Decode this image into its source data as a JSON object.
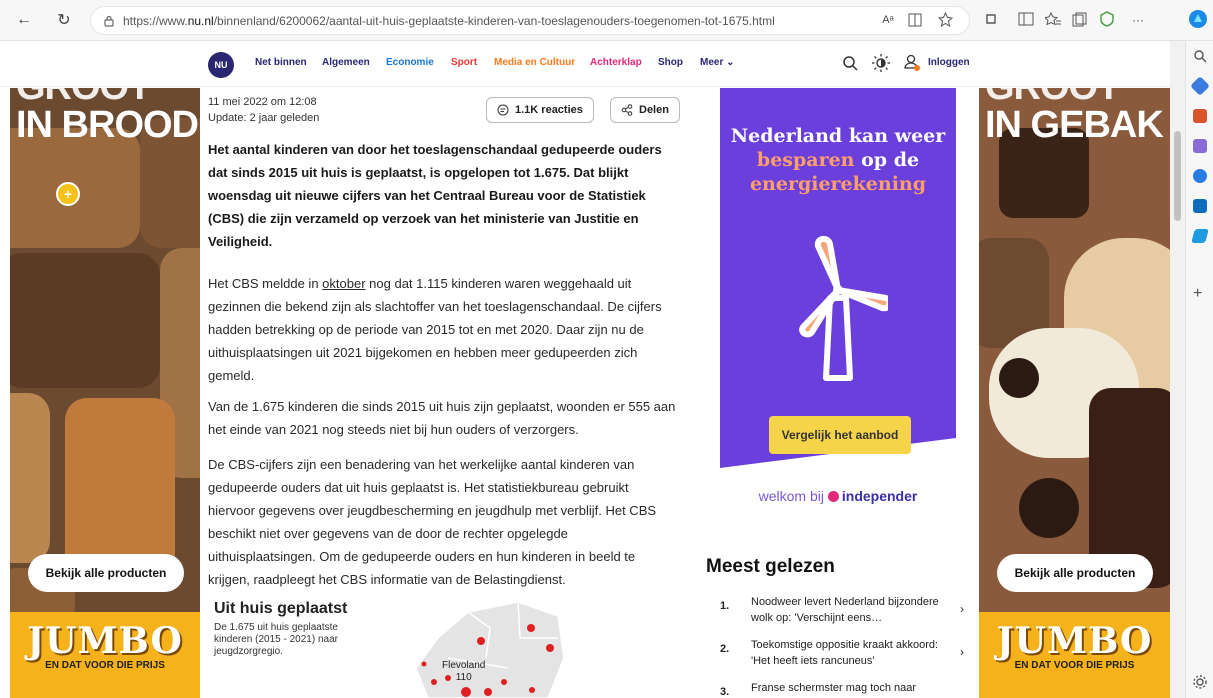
{
  "browser": {
    "url_prefix": "https://www.",
    "url_domain": "nu.nl",
    "url_path": "/binnenland/6200062/aantal-uit-huis-geplaatste-kinderen-van-toeslagenouders-toegenomen-tot-1675.html",
    "nav_back": "←",
    "nav_refresh": "↻",
    "read_aloud": "Aᵃ",
    "more": "···"
  },
  "site_nav": {
    "logo": "NU",
    "items": [
      {
        "label": "Net binnen",
        "color": "#2b2672"
      },
      {
        "label": "Algemeen",
        "color": "#2b2672"
      },
      {
        "label": "Economie",
        "color": "#1976d2"
      },
      {
        "label": "Sport",
        "color": "#e53935"
      },
      {
        "label": "Media en Cultuur",
        "color": "#ff7a1a"
      },
      {
        "label": "Achterklap",
        "color": "#e0287d"
      },
      {
        "label": "Shop",
        "color": "#2b2672"
      },
      {
        "label": "Meer ⌄",
        "color": "#2b2672"
      }
    ],
    "login": "Inloggen"
  },
  "ad_left": {
    "headline_1": "GROOT",
    "headline_2": "IN BROOD",
    "button": "Bekijk alle producten",
    "brand": "JUMBO",
    "tagline": "EN DAT VOOR DIE PRIJS"
  },
  "ad_right": {
    "headline_1": "GROOT",
    "headline_2": "IN GEBAK",
    "button": "Bekijk alle producten",
    "brand": "JUMBO",
    "tagline": "EN DAT VOOR DIE PRIJS"
  },
  "article": {
    "date": "11 mei 2022 om 12:08",
    "update": "Update: 2 jaar geleden",
    "reactions": "1.1K reacties",
    "share": "Delen",
    "lead": "Het aantal kinderen van door het toeslagenschandaal gedupeerde ouders dat sinds 2015 uit huis is geplaatst, is opgelopen tot 1.675. Dat blijkt woensdag uit nieuwe cijfers van het Centraal Bureau voor de Statistiek (CBS) die zijn verzameld op verzoek van het ministerie van Justitie en Veiligheid.",
    "p1_a": "Het CBS meldde in ",
    "p1_link": "oktober",
    "p1_b": " nog dat 1.115 kinderen waren weggehaald uit gezinnen die bekend zijn als slachtoffer van het toeslagenschandaal. De cijfers hadden betrekking op de periode van 2015 tot en met 2020. Daar zijn nu de uithuisplaatsingen uit 2021 bijgekomen en hebben meer gedupeerden zich gemeld.",
    "p2": "Van de 1.675 kinderen die sinds 2015 uit huis zijn geplaatst, woonden er 555 aan het einde van 2021 nog steeds niet bij hun ouders of verzorgers.",
    "p3": "De CBS-cijfers zijn een benadering van het werkelijke aantal kinderen van gedupeerde ouders dat uit huis geplaatst is. Het statistiekbureau gebruikt hiervoor gegevens over jeugdbescherming en jeugdhulp met verblijf. Het CBS beschikt niet over gegevens van de door de rechter opgelegde uithuisplaatsingen. Om de gedupeerde ouders en hun kinderen in beeld te krijgen, raadpleegt het CBS informatie van de Belastingdienst."
  },
  "map": {
    "title": "Uit huis geplaatst",
    "description": "De 1.675 uit huis geplaatste kinderen (2015 - 2021) naar jeugdzorgregio.",
    "region_label": "Flevoland",
    "region_value": "110"
  },
  "ad_mid": {
    "line1": "Nederland kan weer",
    "line2_orange": "besparen",
    "line2_white": " op de",
    "line3": "energierekening",
    "cta": "Vergelijk het aanbod",
    "welkom": "welkom bij ",
    "brand": "independer"
  },
  "most_read": {
    "title": "Meest gelezen",
    "items": [
      {
        "num": "1.",
        "text": "Noodweer levert Nederland bijzondere wolk op: 'Verschijnt eens…"
      },
      {
        "num": "2.",
        "text": "Toekomstige oppositie kraakt akkoord: 'Het heeft iets rancuneus'"
      },
      {
        "num": "3.",
        "text": "Franse schermster mag toch naar"
      }
    ]
  }
}
